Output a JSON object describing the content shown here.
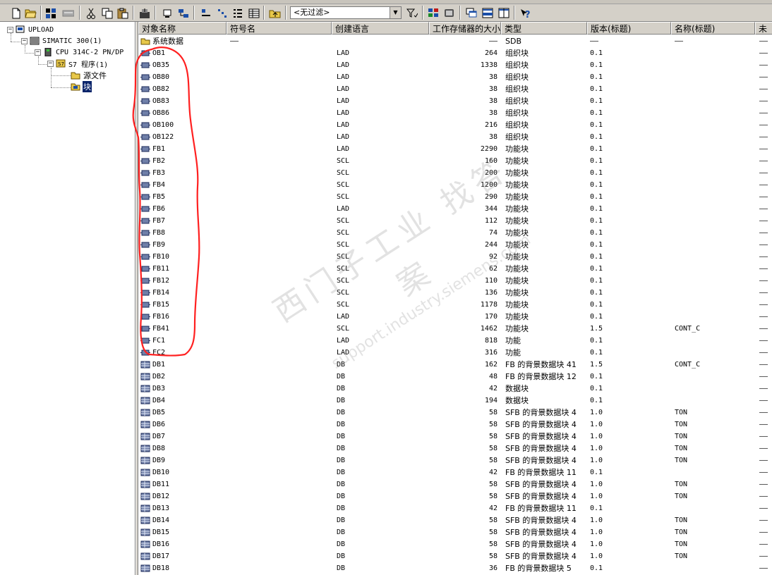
{
  "toolbar": {
    "filter_value": "<无过滤>",
    "icons": [
      "new-icon",
      "open-icon",
      "accessible-nodes-icon",
      "memory-card-icon",
      "cut-icon",
      "copy-icon",
      "paste-icon",
      "download-icon",
      "online-icon",
      "offline-icon",
      "large-icons-icon",
      "small-icons-icon",
      "list-icon",
      "details-icon",
      "up-level-icon",
      "filter-icon",
      "simatic-manager-icon",
      "config-network-icon",
      "arrange-icon",
      "tile-horizontal-icon",
      "tile-vertical-icon",
      "help-icon"
    ]
  },
  "tree": {
    "nodes": [
      {
        "label": "UPLOAD",
        "icon": "project-icon",
        "expander": "-"
      },
      {
        "label": "SIMATIC 300(1)",
        "icon": "station-icon",
        "expander": "-"
      },
      {
        "label": "CPU 314C-2 PN/DP",
        "icon": "cpu-icon",
        "expander": "-"
      },
      {
        "label": "S7 程序(1)",
        "icon": "s7-program-icon",
        "expander": "-"
      },
      {
        "label": "源文件",
        "icon": "folder-icon",
        "expander": ""
      },
      {
        "label": "块",
        "icon": "blocks-folder-icon",
        "expander": "",
        "selected": true
      }
    ]
  },
  "columns": [
    "对象名称",
    "符号名",
    "创建语言",
    "工作存储器的大小",
    "类型",
    "版本(标题)",
    "名称(标题)",
    "未"
  ],
  "rows": [
    {
      "name": "系统数据",
      "symbol": "——",
      "lang": "",
      "size": "——",
      "type": "SDB",
      "version": "——",
      "title": "——",
      "last": "——",
      "icon": "system-data-icon"
    },
    {
      "name": "OB1",
      "symbol": "",
      "lang": "LAD",
      "size": "264",
      "type": "组织块",
      "version": "0.1",
      "title": "",
      "last": "——",
      "icon": "block-icon"
    },
    {
      "name": "OB35",
      "symbol": "",
      "lang": "LAD",
      "size": "1338",
      "type": "组织块",
      "version": "0.1",
      "title": "",
      "last": "——",
      "icon": "block-icon"
    },
    {
      "name": "OB80",
      "symbol": "",
      "lang": "LAD",
      "size": "38",
      "type": "组织块",
      "version": "0.1",
      "title": "",
      "last": "——",
      "icon": "block-icon"
    },
    {
      "name": "OB82",
      "symbol": "",
      "lang": "LAD",
      "size": "38",
      "type": "组织块",
      "version": "0.1",
      "title": "",
      "last": "——",
      "icon": "block-icon"
    },
    {
      "name": "OB83",
      "symbol": "",
      "lang": "LAD",
      "size": "38",
      "type": "组织块",
      "version": "0.1",
      "title": "",
      "last": "——",
      "icon": "block-icon"
    },
    {
      "name": "OB86",
      "symbol": "",
      "lang": "LAD",
      "size": "38",
      "type": "组织块",
      "version": "0.1",
      "title": "",
      "last": "——",
      "icon": "block-icon"
    },
    {
      "name": "OB100",
      "symbol": "",
      "lang": "LAD",
      "size": "216",
      "type": "组织块",
      "version": "0.1",
      "title": "",
      "last": "——",
      "icon": "block-icon"
    },
    {
      "name": "OB122",
      "symbol": "",
      "lang": "LAD",
      "size": "38",
      "type": "组织块",
      "version": "0.1",
      "title": "",
      "last": "——",
      "icon": "block-icon"
    },
    {
      "name": "FB1",
      "symbol": "",
      "lang": "LAD",
      "size": "2290",
      "type": "功能块",
      "version": "0.1",
      "title": "",
      "last": "——",
      "icon": "block-icon"
    },
    {
      "name": "FB2",
      "symbol": "",
      "lang": "SCL",
      "size": "160",
      "type": "功能块",
      "version": "0.1",
      "title": "",
      "last": "——",
      "icon": "block-icon"
    },
    {
      "name": "FB3",
      "symbol": "",
      "lang": "SCL",
      "size": "200",
      "type": "功能块",
      "version": "0.1",
      "title": "",
      "last": "——",
      "icon": "block-icon"
    },
    {
      "name": "FB4",
      "symbol": "",
      "lang": "SCL",
      "size": "1200",
      "type": "功能块",
      "version": "0.1",
      "title": "",
      "last": "——",
      "icon": "block-icon"
    },
    {
      "name": "FB5",
      "symbol": "",
      "lang": "SCL",
      "size": "290",
      "type": "功能块",
      "version": "0.1",
      "title": "",
      "last": "——",
      "icon": "block-icon"
    },
    {
      "name": "FB6",
      "symbol": "",
      "lang": "LAD",
      "size": "344",
      "type": "功能块",
      "version": "0.1",
      "title": "",
      "last": "——",
      "icon": "block-icon"
    },
    {
      "name": "FB7",
      "symbol": "",
      "lang": "SCL",
      "size": "112",
      "type": "功能块",
      "version": "0.1",
      "title": "",
      "last": "——",
      "icon": "block-icon"
    },
    {
      "name": "FB8",
      "symbol": "",
      "lang": "SCL",
      "size": "74",
      "type": "功能块",
      "version": "0.1",
      "title": "",
      "last": "——",
      "icon": "block-icon"
    },
    {
      "name": "FB9",
      "symbol": "",
      "lang": "SCL",
      "size": "244",
      "type": "功能块",
      "version": "0.1",
      "title": "",
      "last": "——",
      "icon": "block-icon"
    },
    {
      "name": "FB10",
      "symbol": "",
      "lang": "SCL",
      "size": "92",
      "type": "功能块",
      "version": "0.1",
      "title": "",
      "last": "——",
      "icon": "block-icon"
    },
    {
      "name": "FB11",
      "symbol": "",
      "lang": "SCL",
      "size": "62",
      "type": "功能块",
      "version": "0.1",
      "title": "",
      "last": "——",
      "icon": "block-icon"
    },
    {
      "name": "FB12",
      "symbol": "",
      "lang": "SCL",
      "size": "110",
      "type": "功能块",
      "version": "0.1",
      "title": "",
      "last": "——",
      "icon": "block-icon"
    },
    {
      "name": "FB14",
      "symbol": "",
      "lang": "SCL",
      "size": "136",
      "type": "功能块",
      "version": "0.1",
      "title": "",
      "last": "——",
      "icon": "block-icon"
    },
    {
      "name": "FB15",
      "symbol": "",
      "lang": "SCL",
      "size": "1178",
      "type": "功能块",
      "version": "0.1",
      "title": "",
      "last": "——",
      "icon": "block-icon"
    },
    {
      "name": "FB16",
      "symbol": "",
      "lang": "LAD",
      "size": "170",
      "type": "功能块",
      "version": "0.1",
      "title": "",
      "last": "——",
      "icon": "block-icon"
    },
    {
      "name": "FB41",
      "symbol": "",
      "lang": "SCL",
      "size": "1462",
      "type": "功能块",
      "version": "1.5",
      "title": "CONT_C",
      "last": "——",
      "icon": "block-icon"
    },
    {
      "name": "FC1",
      "symbol": "",
      "lang": "LAD",
      "size": "818",
      "type": "功能",
      "version": "0.1",
      "title": "",
      "last": "——",
      "icon": "block-icon"
    },
    {
      "name": "FC2",
      "symbol": "",
      "lang": "LAD",
      "size": "316",
      "type": "功能",
      "version": "0.1",
      "title": "",
      "last": "——",
      "icon": "block-icon"
    },
    {
      "name": "DB1",
      "symbol": "",
      "lang": "DB",
      "size": "162",
      "type": "FB 的背景数据块 41",
      "version": "1.5",
      "title": "CONT_C",
      "last": "——",
      "icon": "db-icon"
    },
    {
      "name": "DB2",
      "symbol": "",
      "lang": "DB",
      "size": "48",
      "type": "FB 的背景数据块 12",
      "version": "0.1",
      "title": "",
      "last": "——",
      "icon": "db-icon"
    },
    {
      "name": "DB3",
      "symbol": "",
      "lang": "DB",
      "size": "42",
      "type": "数据块",
      "version": "0.1",
      "title": "",
      "last": "——",
      "icon": "db-icon"
    },
    {
      "name": "DB4",
      "symbol": "",
      "lang": "DB",
      "size": "194",
      "type": "数据块",
      "version": "0.1",
      "title": "",
      "last": "——",
      "icon": "db-icon"
    },
    {
      "name": "DB5",
      "symbol": "",
      "lang": "DB",
      "size": "58",
      "type": "SFB 的背景数据块 4",
      "version": "1.0",
      "title": "TON",
      "last": "——",
      "icon": "db-icon"
    },
    {
      "name": "DB6",
      "symbol": "",
      "lang": "DB",
      "size": "58",
      "type": "SFB 的背景数据块 4",
      "version": "1.0",
      "title": "TON",
      "last": "——",
      "icon": "db-icon"
    },
    {
      "name": "DB7",
      "symbol": "",
      "lang": "DB",
      "size": "58",
      "type": "SFB 的背景数据块 4",
      "version": "1.0",
      "title": "TON",
      "last": "——",
      "icon": "db-icon"
    },
    {
      "name": "DB8",
      "symbol": "",
      "lang": "DB",
      "size": "58",
      "type": "SFB 的背景数据块 4",
      "version": "1.0",
      "title": "TON",
      "last": "——",
      "icon": "db-icon"
    },
    {
      "name": "DB9",
      "symbol": "",
      "lang": "DB",
      "size": "58",
      "type": "SFB 的背景数据块 4",
      "version": "1.0",
      "title": "TON",
      "last": "——",
      "icon": "db-icon"
    },
    {
      "name": "DB10",
      "symbol": "",
      "lang": "DB",
      "size": "42",
      "type": "FB 的背景数据块 11",
      "version": "0.1",
      "title": "",
      "last": "——",
      "icon": "db-icon"
    },
    {
      "name": "DB11",
      "symbol": "",
      "lang": "DB",
      "size": "58",
      "type": "SFB 的背景数据块 4",
      "version": "1.0",
      "title": "TON",
      "last": "——",
      "icon": "db-icon"
    },
    {
      "name": "DB12",
      "symbol": "",
      "lang": "DB",
      "size": "58",
      "type": "SFB 的背景数据块 4",
      "version": "1.0",
      "title": "TON",
      "last": "——",
      "icon": "db-icon"
    },
    {
      "name": "DB13",
      "symbol": "",
      "lang": "DB",
      "size": "42",
      "type": "FB 的背景数据块 11",
      "version": "0.1",
      "title": "",
      "last": "——",
      "icon": "db-icon"
    },
    {
      "name": "DB14",
      "symbol": "",
      "lang": "DB",
      "size": "58",
      "type": "SFB 的背景数据块 4",
      "version": "1.0",
      "title": "TON",
      "last": "——",
      "icon": "db-icon"
    },
    {
      "name": "DB15",
      "symbol": "",
      "lang": "DB",
      "size": "58",
      "type": "SFB 的背景数据块 4",
      "version": "1.0",
      "title": "TON",
      "last": "——",
      "icon": "db-icon"
    },
    {
      "name": "DB16",
      "symbol": "",
      "lang": "DB",
      "size": "58",
      "type": "SFB 的背景数据块 4",
      "version": "1.0",
      "title": "TON",
      "last": "——",
      "icon": "db-icon"
    },
    {
      "name": "DB17",
      "symbol": "",
      "lang": "DB",
      "size": "58",
      "type": "SFB 的背景数据块 4",
      "version": "1.0",
      "title": "TON",
      "last": "——",
      "icon": "db-icon"
    },
    {
      "name": "DB18",
      "symbol": "",
      "lang": "DB",
      "size": "36",
      "type": "FB 的背景数据块 5",
      "version": "0.1",
      "title": "",
      "last": "——",
      "icon": "db-icon"
    }
  ],
  "watermark": {
    "line1": "西门子工业",
    "line2": "support.industry.siemens.com",
    "line3": "找答案"
  },
  "colors": {
    "chrome": "#d4d0c8",
    "selection": "#0a246a",
    "annotation": "#ff2020"
  }
}
